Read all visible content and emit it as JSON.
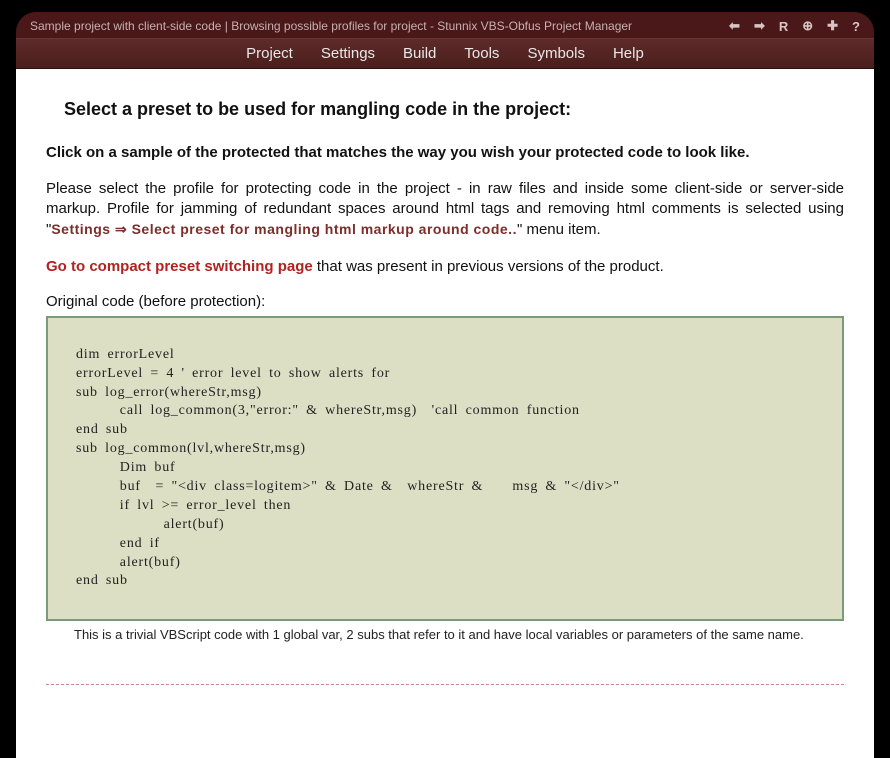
{
  "titlebar": {
    "title": "Sample project with client-side code | Browsing possible profiles for project - Stunnix VBS-Obfus Project Manager",
    "icons": {
      "back": "⬅",
      "forward": "➡",
      "reload": "R",
      "zoom": "⊕",
      "add": "✚",
      "help": "?"
    }
  },
  "menubar": {
    "items": [
      "Project",
      "Settings",
      "Build",
      "Tools",
      "Symbols",
      "Help"
    ]
  },
  "content": {
    "heading": "Select a preset to be used for mangling code in the project:",
    "intro_bold": "Click on a sample of the protected that matches the way you wish your protected code to look like.",
    "intro_para_pre": "Please select the profile for protecting code in the project - in raw files and inside some client-side or server-side markup. Profile for jamming of redundant spaces around html tags and removing html comments is selected using \"",
    "intro_menu_ref": "Settings ⇒ Select preset for mangling html markup around code..",
    "intro_para_post": "\" menu item.",
    "compact_link": "Go to compact preset switching page",
    "compact_rest": " that was present in previous versions of the product.",
    "original_label": "Original code (before protection):",
    "code": "dim errorLevel\nerrorLevel = 4 ' error level to show alerts for\nsub log_error(whereStr,msg)\n      call log_common(3,\"error:\" & whereStr,msg)  'call common function\nend sub\nsub log_common(lvl,whereStr,msg)\n      Dim buf\n      buf  = \"<div class=logitem>\" & Date &  whereStr &    msg & \"</div>\"\n      if lvl >= error_level then\n            alert(buf)\n      end if\n      alert(buf)\nend sub",
    "code_caption": "This is a trivial VBScript code with 1 global var, 2 subs that refer to it and have local variables or parameters of the same name."
  }
}
